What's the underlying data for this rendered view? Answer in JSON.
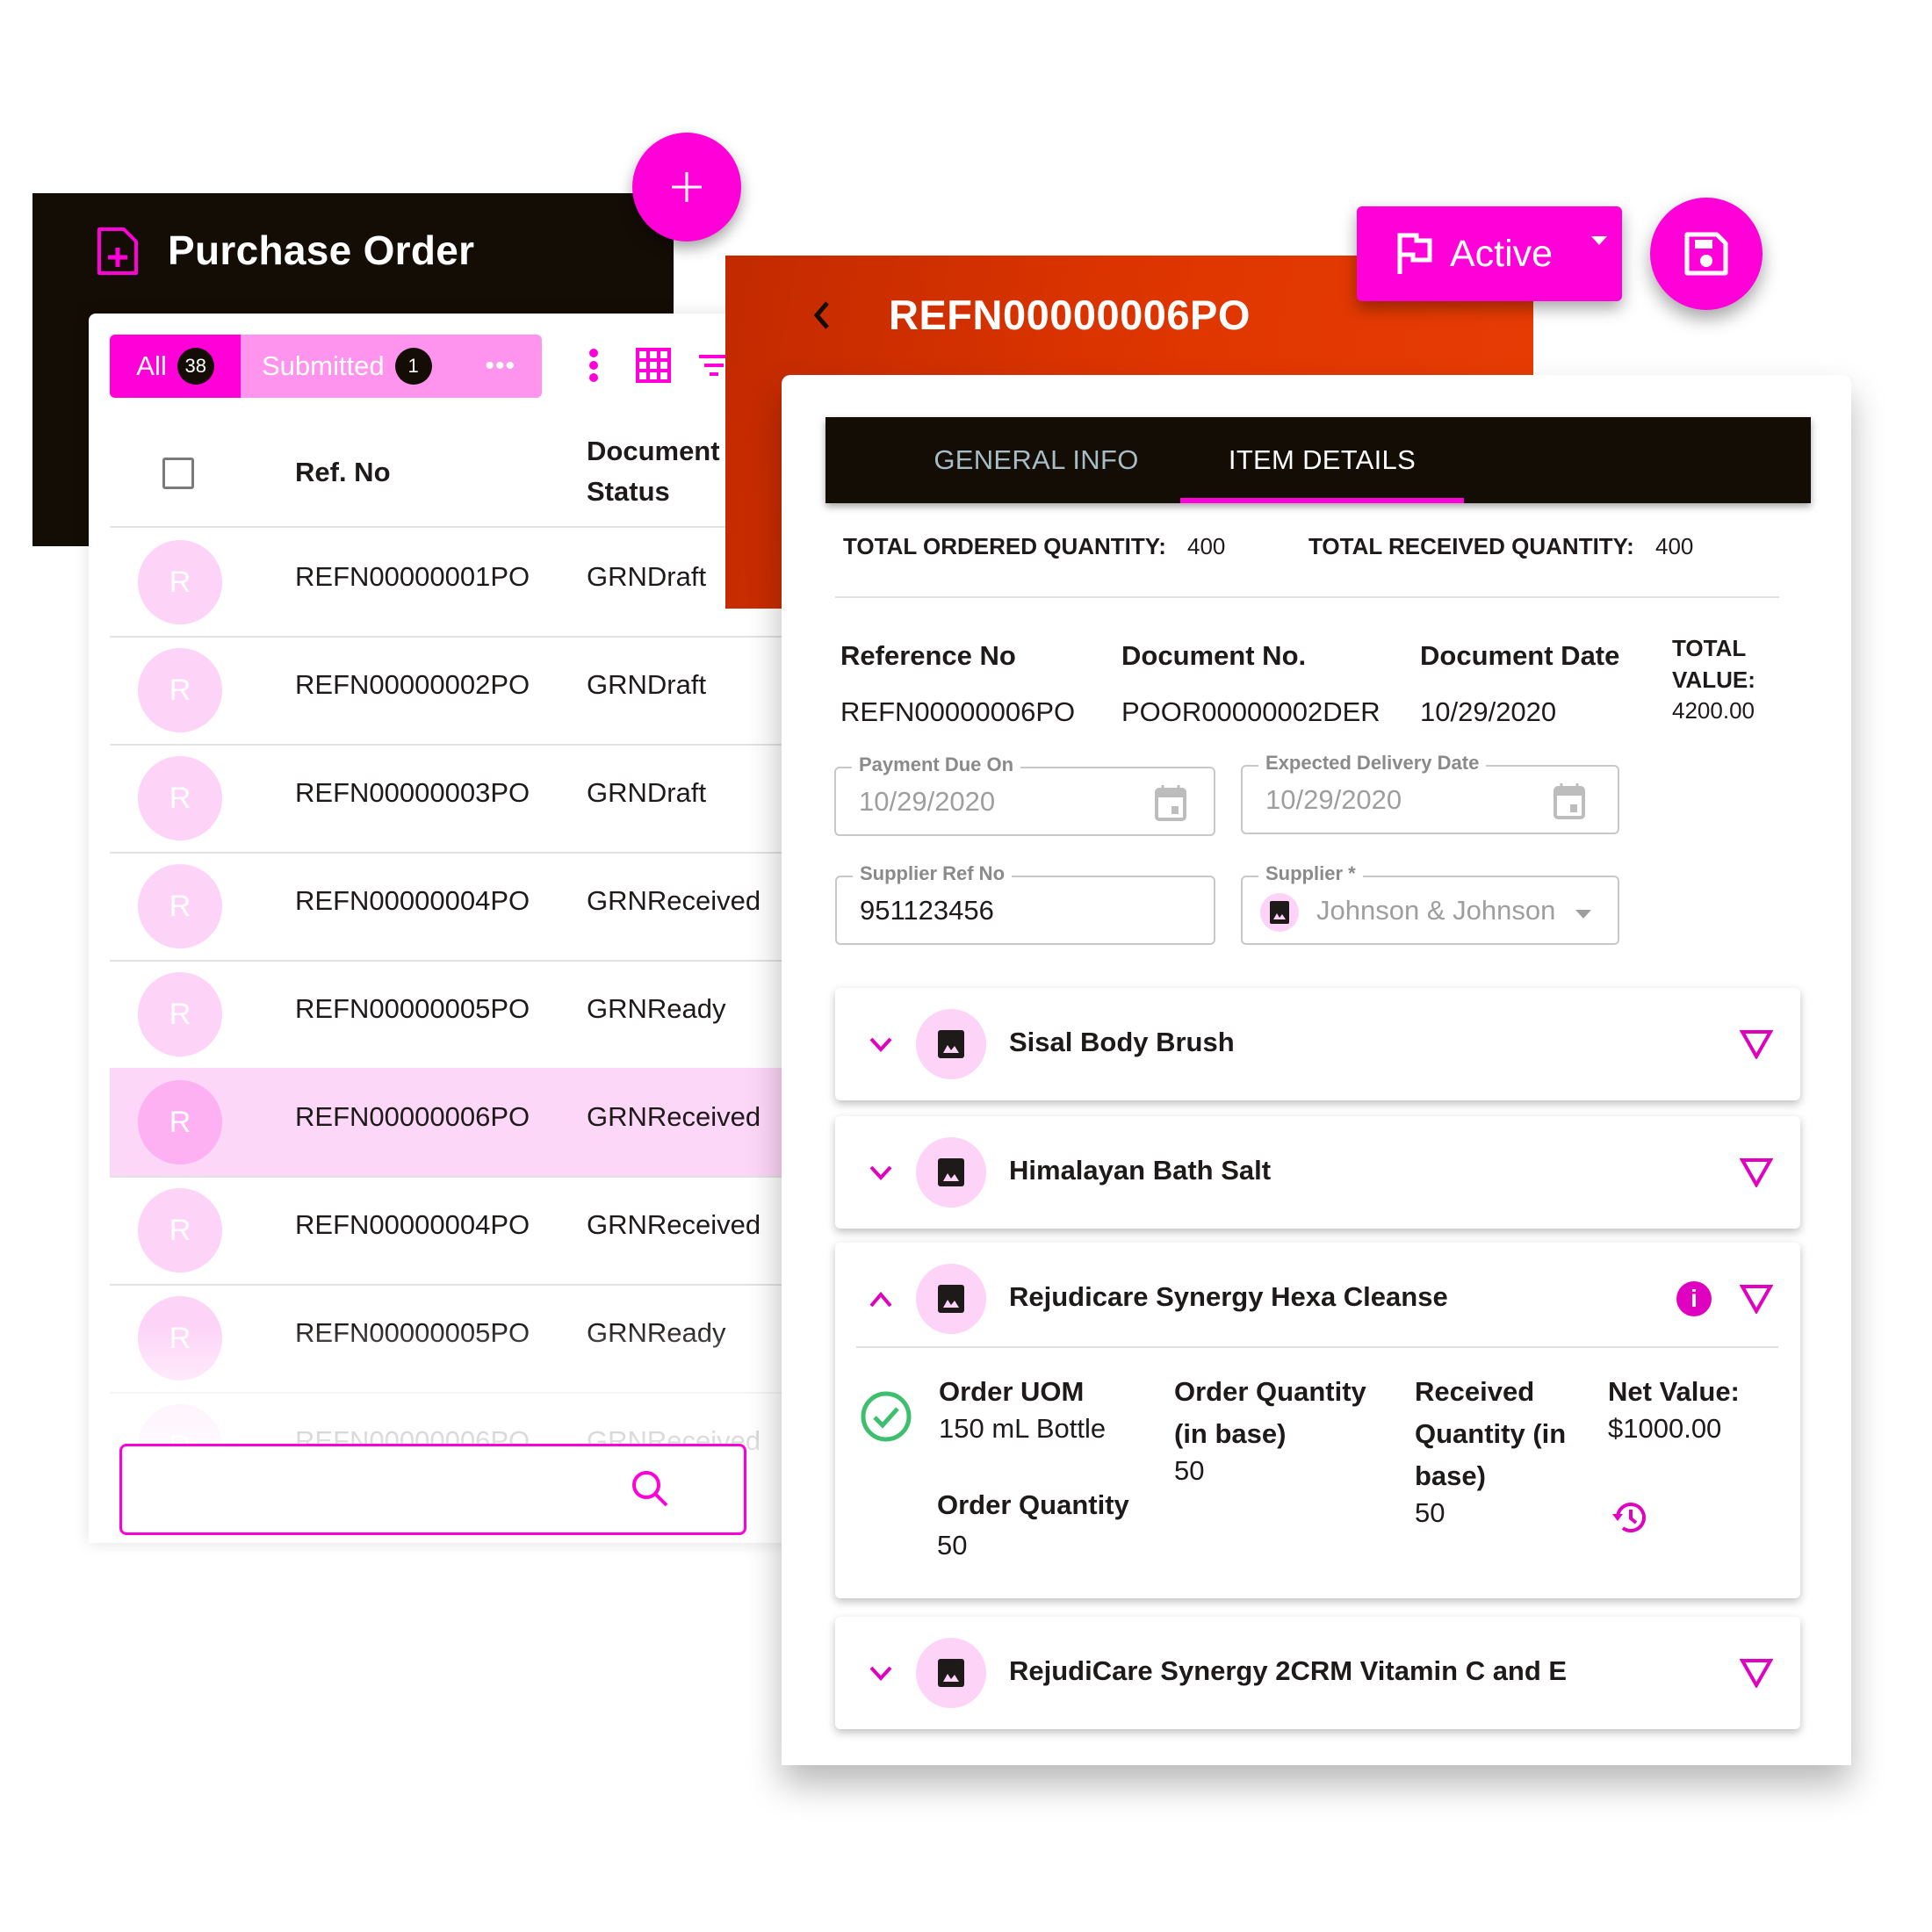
{
  "colors": {
    "accent": "#ff00d8",
    "accent_light": "#ff94ee",
    "header_dark": "#140d06",
    "header_orange": "#e03600",
    "success": "#3dbf6e",
    "selected_row": "#fdd7f8"
  },
  "list_panel": {
    "title": "Purchase Order",
    "title_icon": "file-add-icon",
    "add_button_icon": "plus-icon",
    "filters": {
      "all_label": "All",
      "all_count": "38",
      "submitted_label": "Submitted",
      "submitted_count": "1",
      "more_label": "•••"
    },
    "toolbar_icons": [
      "more-vertical-icon",
      "grid-view-icon",
      "filter-icon"
    ],
    "columns": {
      "ref_no": "Ref. No",
      "status_line1": "Document",
      "status_line2": "Status"
    },
    "rows": [
      {
        "avatar": "R",
        "ref_no": "REFN00000001PO",
        "status": "GRNDraft",
        "selected": false
      },
      {
        "avatar": "R",
        "ref_no": "REFN00000002PO",
        "status": "GRNDraft",
        "selected": false
      },
      {
        "avatar": "R",
        "ref_no": "REFN00000003PO",
        "status": "GRNDraft",
        "selected": false
      },
      {
        "avatar": "R",
        "ref_no": "REFN00000004PO",
        "status": "GRNReceived",
        "selected": false
      },
      {
        "avatar": "R",
        "ref_no": "REFN00000005PO",
        "status": "GRNReady",
        "selected": false
      },
      {
        "avatar": "R",
        "ref_no": "REFN00000006PO",
        "status": "GRNReceived",
        "selected": true
      },
      {
        "avatar": "R",
        "ref_no": "REFN00000004PO",
        "status": "GRNReceived",
        "selected": false
      },
      {
        "avatar": "R",
        "ref_no": "REFN00000005PO",
        "status": "GRNReady",
        "selected": false
      },
      {
        "avatar": "R",
        "ref_no": "REFN00000006PO",
        "status": "GRNReceived",
        "selected": false
      }
    ],
    "search": {
      "value": "",
      "icon": "search-icon"
    }
  },
  "detail_panel": {
    "title": "REFN00000006PO",
    "status_button": {
      "label": "Active",
      "icon": "flag-icon"
    },
    "save_icon": "save-icon",
    "tabs": [
      {
        "label": "GENERAL INFO",
        "active": false
      },
      {
        "label": "ITEM DETAILS",
        "active": true
      }
    ],
    "totals": {
      "ordered_label": "TOTAL ORDERED QUANTITY:",
      "ordered_value": "400",
      "received_label": "TOTAL RECEIVED QUANTITY:",
      "received_value": "400"
    },
    "info": {
      "reference_label": "Reference No",
      "reference_value": "REFN00000006PO",
      "document_no_label": "Document No.",
      "document_no_value": "POOR00000002DER",
      "document_date_label": "Document Date",
      "document_date_value": "10/29/2020",
      "total_value_label_1": "TOTAL",
      "total_value_label_2": "VALUE:",
      "total_value": "4200.00"
    },
    "fields": {
      "payment_due_label": "Payment Due On",
      "payment_due_value": "10/29/2020",
      "delivery_label": "Expected Delivery Date",
      "delivery_value": "10/29/2020",
      "supplier_ref_label": "Supplier Ref No",
      "supplier_ref_value": "951123456",
      "supplier_label": "Supplier *",
      "supplier_value": "Johnson & Johnson"
    },
    "items": [
      {
        "name": "Sisal Body Brush",
        "expanded": false
      },
      {
        "name": "Himalayan Bath Salt",
        "expanded": false
      },
      {
        "name": "Rejudicare Synergy Hexa Cleanse",
        "expanded": true,
        "has_info": true
      },
      {
        "name": "RejudiCare Synergy 2CRM Vitamin C and E",
        "expanded": false
      }
    ],
    "expanded_item": {
      "order_uom_label": "Order UOM",
      "order_uom_value": "150 mL Bottle",
      "order_qty_label": "Order Quantity",
      "order_qty_value": "50",
      "order_qty_base_label_1": "Order Quantity",
      "order_qty_base_label_2": "(in base)",
      "order_qty_base_value": "50",
      "received_qty_label_1": "Received",
      "received_qty_label_2": "Quantity (in",
      "received_qty_label_3": "base)",
      "received_qty_value": "50",
      "net_value_label": "Net Value:",
      "net_value": "$1000.00"
    }
  }
}
